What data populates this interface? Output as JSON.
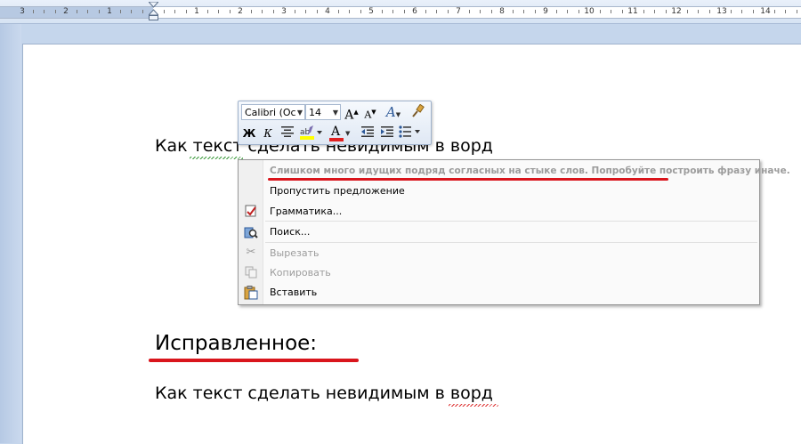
{
  "ruler": {
    "numbers": [
      "3",
      "2",
      "1",
      "1",
      "2",
      "3",
      "4",
      "5",
      "6",
      "7",
      "8",
      "9",
      "10",
      "11",
      "12",
      "13",
      "14"
    ]
  },
  "document": {
    "line1": "Как текст сделать невидимым в ворд",
    "heading": "Исправленное:",
    "line2": "Как текст сделать невидимым в ворд"
  },
  "mini_toolbar": {
    "font_name": "Calibri (Ос",
    "font_size": "14",
    "grow_font": "A",
    "shrink_font": "A",
    "styles": "A",
    "bold": "Ж",
    "italic": "К",
    "font_color_letter": "A",
    "font_color": "#e02020",
    "highlight_color": "#ffff00"
  },
  "context_menu": {
    "grammar_hint": "Слишком много идущих подряд согласных на стыке слов. Попробуйте построить фразу иначе.",
    "items": [
      {
        "label": "Пропустить предложение",
        "icon": "",
        "enabled": true
      },
      {
        "label": "Грамматика...",
        "icon": "grammar-icon",
        "enabled": true
      },
      {
        "label": "Поиск...",
        "icon": "research-icon",
        "enabled": true
      },
      {
        "label": "Вырезать",
        "icon": "scissors-icon",
        "enabled": false
      },
      {
        "label": "Копировать",
        "icon": "copy-icon",
        "enabled": false
      },
      {
        "label": "Вставить",
        "icon": "paste-icon",
        "enabled": true
      }
    ]
  },
  "colors": {
    "annotation_red": "#d9151c",
    "squiggle_green": "#3c9a3c"
  }
}
